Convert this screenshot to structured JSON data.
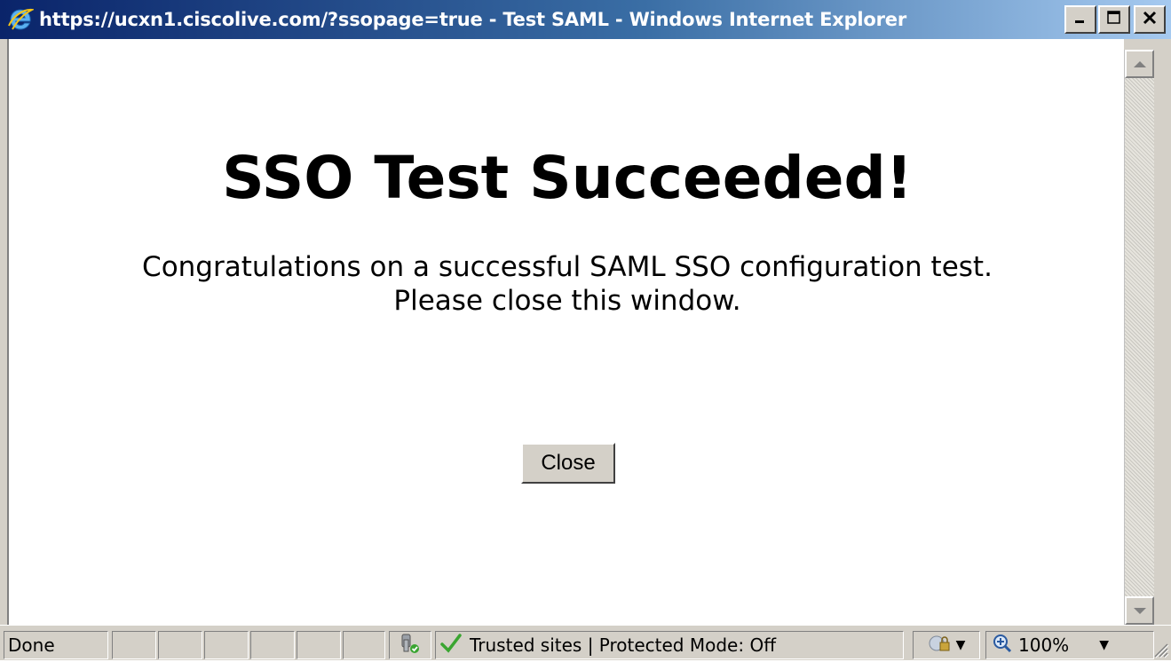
{
  "window": {
    "title": "https://ucxn1.ciscolive.com/?ssopage=true - Test SAML - Windows Internet Explorer",
    "icon": "ie-icon",
    "buttons": {
      "minimize": "minimize-icon",
      "maximize": "maximize-icon",
      "close": "close-icon"
    }
  },
  "page": {
    "heading": "SSO Test Succeeded!",
    "message_line1": "Congratulations on a successful SAML SSO configuration test.",
    "message_line2": "Please close this window.",
    "close_button_label": "Close"
  },
  "statusbar": {
    "status_text": "Done",
    "security_zone": "Trusted sites | Protected Mode: Off",
    "zoom": "100%",
    "icons": [
      "security-report-icon",
      "checkmark-icon",
      "protected-mode-icon",
      "zoom-icon"
    ]
  },
  "colors": {
    "titlebar_start": "#0a246a",
    "titlebar_end": "#a6caf0",
    "chrome": "#d4d0c8",
    "check_green": "#3aa531"
  }
}
